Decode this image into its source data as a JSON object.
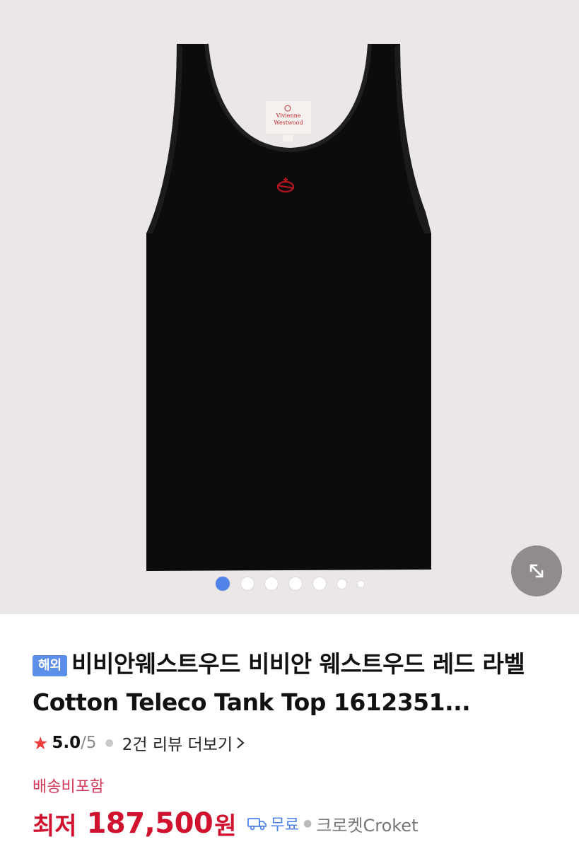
{
  "gallery": {
    "active_index": 0,
    "total_images": 7,
    "image_subject": "Black ribbed tank top with red orb logo and Vivienne Westwood neck label",
    "label_text": [
      "Vivienne",
      "Westwood"
    ],
    "expand_icon": "expand-arrows-icon"
  },
  "product": {
    "badge": "해외",
    "title": "비비안웨스트우드 비비안 웨스트우드 레드 라벨 Cotton Teleco Tank Top 1612351..."
  },
  "rating": {
    "icon": "star-icon",
    "value": "5.0",
    "max": "/5",
    "reviews_link": "2건 리뷰 더보기",
    "chevron_icon": "chevron-right-icon"
  },
  "shipping": {
    "note": "배송비포함"
  },
  "price": {
    "label": "최저",
    "value": "187,500",
    "unit": "원",
    "delivery_icon": "truck-icon",
    "delivery_label": "무료",
    "seller": "크로켓Croket"
  },
  "colors": {
    "accent_blue": "#4f83ea",
    "price_red": "#d0122e",
    "star_red": "#ee3b3b",
    "gallery_bg": "#ebe7e6"
  }
}
